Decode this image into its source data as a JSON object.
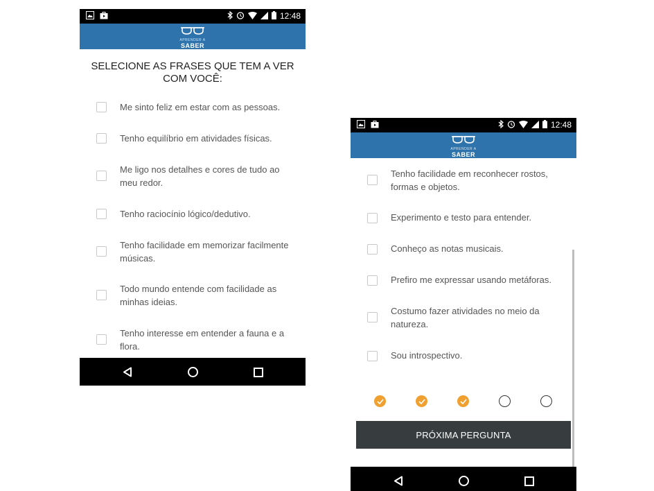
{
  "status": {
    "time": "12:48"
  },
  "app": {
    "logo_small": "APRENDER A",
    "logo_big": "SABER"
  },
  "left_screen": {
    "title": "SELECIONE AS FRASES QUE TEM A VER COM VOCÊ:",
    "options": [
      {
        "label": "Me sinto feliz em estar com as pessoas.",
        "checked": false
      },
      {
        "label": "Tenho equilíbrio em atividades físicas.",
        "checked": false
      },
      {
        "label": "Me ligo nos detalhes e cores de tudo ao meu redor.",
        "checked": false
      },
      {
        "label": "Tenho raciocínio lógico/dedutivo.",
        "checked": false
      },
      {
        "label": "Tenho facilidade em memorizar facilmente músicas.",
        "checked": false
      },
      {
        "label": "Todo mundo entende com facilidade as minhas ideias.",
        "checked": false
      },
      {
        "label": "Tenho interesse em entender a fauna e a flora.",
        "checked": false
      }
    ]
  },
  "right_screen": {
    "options": [
      {
        "label": "Tenho facilidade em reconhecer rostos, formas e objetos.",
        "checked": false
      },
      {
        "label": "Experimento e testo para entender.",
        "checked": false
      },
      {
        "label": "Conheço as notas musicais.",
        "checked": false
      },
      {
        "label": "Prefiro me expressar usando metáforas.",
        "checked": false
      },
      {
        "label": "Costumo fazer atividades no meio da natureza.",
        "checked": false
      },
      {
        "label": "Sou introspectivo.",
        "checked": false
      }
    ],
    "progress": {
      "completed": 3,
      "total": 5
    },
    "next_button": "PRÓXIMA PERGUNTA"
  },
  "colors": {
    "appbar": "#2e73ac",
    "accent": "#f0a030",
    "button": "#373c3e"
  }
}
